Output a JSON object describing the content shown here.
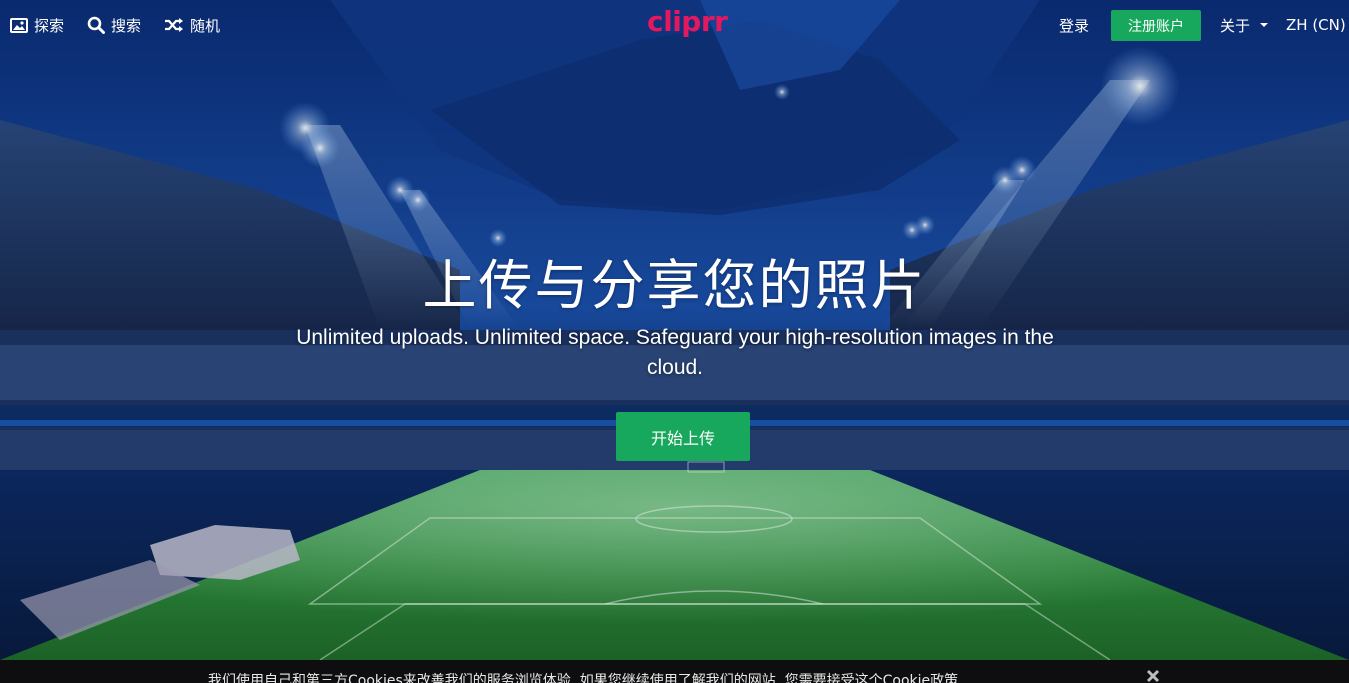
{
  "nav": {
    "explore_label": "探索",
    "search_label": "搜索",
    "random_label": "随机",
    "logo": "cliprr",
    "login_label": "登录",
    "signup_label": "注册账户",
    "about_label": "关于",
    "language_label": "ZH (CN)"
  },
  "hero": {
    "title": "上传与分享您的照片",
    "subtitle": "Unlimited uploads. Unlimited space. Safeguard your high-resolution images in the cloud.",
    "cta_label": "开始上传"
  },
  "cookie_bar": {
    "text": "我们使用自己和第三方Cookies来改善我们的服务浏览体验. 如果您继续使用了解我们的网站, 您需要接受这个Cookie政策"
  },
  "icons": {
    "explore": "image-icon",
    "search": "search-icon",
    "random": "shuffle-icon",
    "dropdown": "caret-down-icon",
    "close": "close-icon"
  },
  "colors": {
    "brand": "#e4185f",
    "accent_green": "#17a85d",
    "cookie_bg": "#0e0e10"
  }
}
